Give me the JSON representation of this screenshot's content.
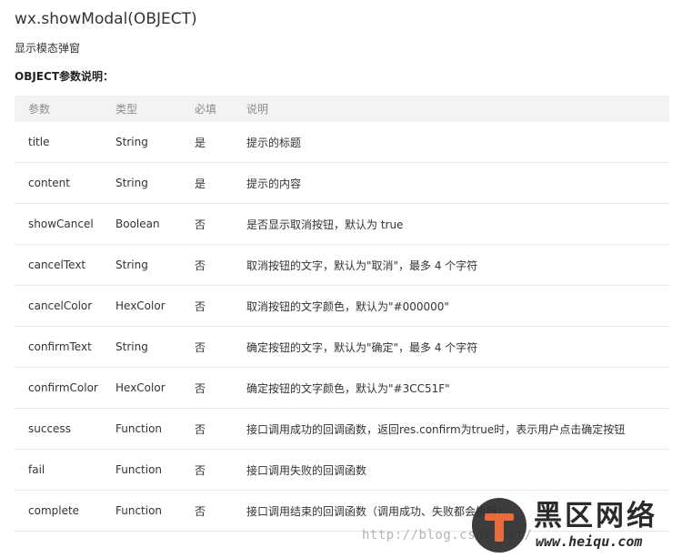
{
  "doc": {
    "title": "wx.showModal(OBJECT)",
    "subtitle": "显示模态弹窗",
    "section_label": "OBJECT参数说明："
  },
  "table": {
    "headers": [
      "参数",
      "类型",
      "必填",
      "说明"
    ],
    "rows": [
      {
        "name": "title",
        "type": "String",
        "required": "是",
        "desc": "提示的标题"
      },
      {
        "name": "content",
        "type": "String",
        "required": "是",
        "desc": "提示的内容"
      },
      {
        "name": "showCancel",
        "type": "Boolean",
        "required": "否",
        "desc": "是否显示取消按钮，默认为 true"
      },
      {
        "name": "cancelText",
        "type": "String",
        "required": "否",
        "desc": "取消按钮的文字，默认为\"取消\"，最多 4 个字符"
      },
      {
        "name": "cancelColor",
        "type": "HexColor",
        "required": "否",
        "desc": "取消按钮的文字颜色，默认为\"#000000\""
      },
      {
        "name": "confirmText",
        "type": "String",
        "required": "否",
        "desc": "确定按钮的文字，默认为\"确定\"，最多 4 个字符"
      },
      {
        "name": "confirmColor",
        "type": "HexColor",
        "required": "否",
        "desc": "确定按钮的文字颜色，默认为\"#3CC51F\""
      },
      {
        "name": "success",
        "type": "Function",
        "required": "否",
        "desc": "接口调用成功的回调函数，返回res.confirm为true时，表示用户点击确定按钮"
      },
      {
        "name": "fail",
        "type": "Function",
        "required": "否",
        "desc": "接口调用失败的回调函数"
      },
      {
        "name": "complete",
        "type": "Function",
        "required": "否",
        "desc": "接口调用结束的回调函数（调用成功、失败都会执行）"
      }
    ]
  },
  "watermark": {
    "text": "http://blog.csdn.net/",
    "logo_cn": "黑区网络",
    "logo_en": "www.heiqu.com",
    "accent_color": "#e8612c"
  }
}
